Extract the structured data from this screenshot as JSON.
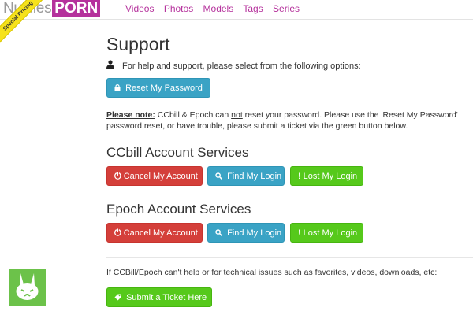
{
  "header": {
    "logo_part1": "NubilesPorn",
    "logo_part2": "PORN",
    "logo_prefix": "Nubiles",
    "ribbon": "Special Pricing",
    "nav": [
      "Videos",
      "Photos",
      "Models",
      "Tags",
      "Series"
    ]
  },
  "page": {
    "title": "Support",
    "help_text": "For help and support, please select from the following options:",
    "reset_button": "Reset My Password",
    "note_label": "Please note:",
    "note_text_1": " CCbill & Epoch can ",
    "note_not": "not",
    "note_text_2": " reset your password. Please use the 'Reset My Password'",
    "note_line2": "password reset, or have trouble, please submit a ticket via the green button below."
  },
  "ccbill": {
    "heading": "CCbill Account Services",
    "cancel": "Cancel My Account",
    "find": "Find My Login",
    "lost": "Lost My Login"
  },
  "epoch": {
    "heading": "Epoch Account Services",
    "cancel": "Cancel My Account",
    "find": "Find My Login",
    "lost": "Lost My Login"
  },
  "ticket": {
    "text": "If CCBill/Epoch can't help or for technical issues such as favorites, videos, downloads, etc:",
    "button": "Submit a Ticket Here"
  },
  "colors": {
    "brand": "#b5319c",
    "blue": "#3aa3c5",
    "red": "#d43f3a",
    "green": "#56c91b",
    "ribbon": "#f6e21b"
  }
}
